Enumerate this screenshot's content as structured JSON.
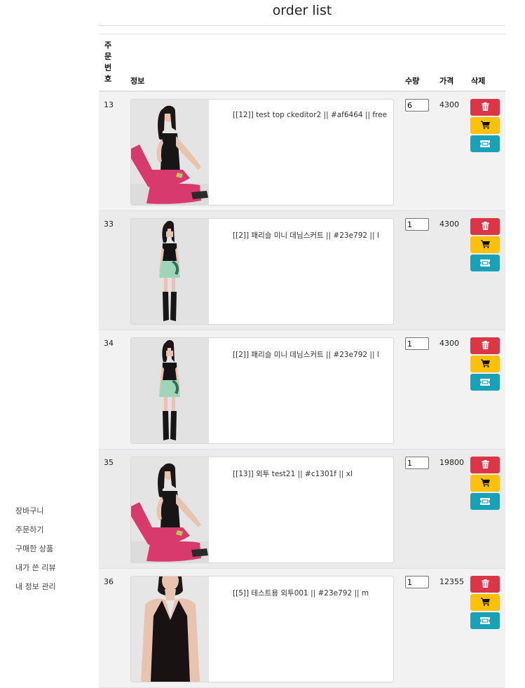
{
  "page": {
    "title": "order list"
  },
  "sidebar": {
    "items": [
      "장바구니",
      "주문하기",
      "구매한 상품",
      "내가 쓴 리뷰",
      "내 정보 관리"
    ]
  },
  "table": {
    "headers": {
      "no": "주문번호",
      "info": "정보",
      "qty": "수량",
      "price": "가격",
      "delete": "삭제"
    },
    "rows": [
      {
        "no": "13",
        "text": "[[12]] test top ckeditor2 || #af6464 || free",
        "qty": "6",
        "price": "4300",
        "image": "pink-pants-model"
      },
      {
        "no": "33",
        "text": "[[2]] 패리슬 미니 데님스커트 || #23e792 || l",
        "qty": "1",
        "price": "4300",
        "image": "mint-skirt-model"
      },
      {
        "no": "34",
        "text": "[[2]] 패리슬 미니 데님스커트 || #23e792 || l",
        "qty": "1",
        "price": "4300",
        "image": "mint-skirt-model"
      },
      {
        "no": "35",
        "text": "[[13]] 외투 test21 || #c1301f || xl",
        "qty": "1",
        "price": "19800",
        "image": "pink-pants-model"
      },
      {
        "no": "36",
        "text": "[[5]] 테스트용 외투001 || #23e792 || m",
        "qty": "1",
        "price": "12355",
        "image": "halter-top-model"
      }
    ]
  },
  "colors": {
    "delete": "#dc3545",
    "cart": "#ffc107",
    "ticket": "#17a2b8"
  },
  "icons": {
    "delete": "trash-icon",
    "cart": "cart-icon",
    "ticket": "ticket-icon"
  }
}
